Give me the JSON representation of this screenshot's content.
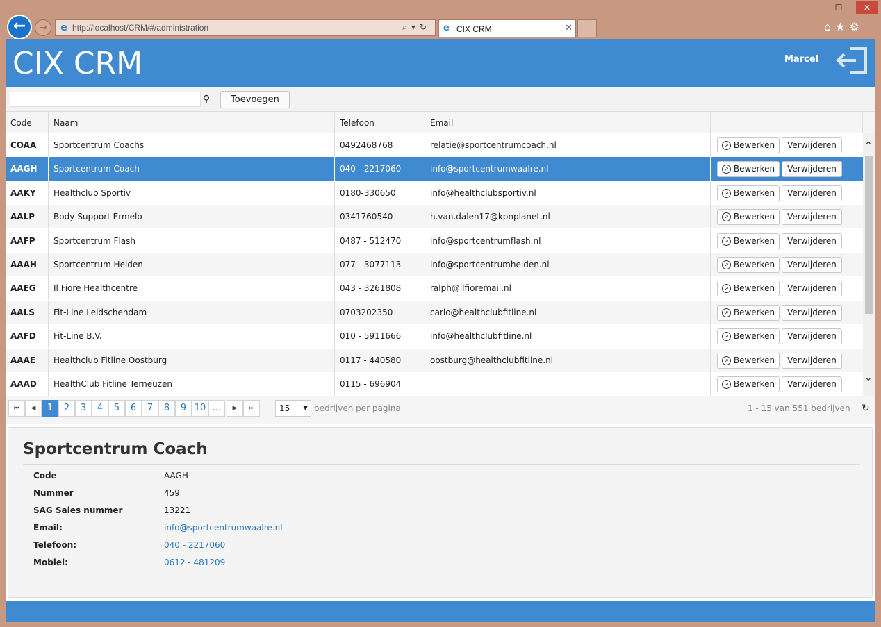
{
  "browser": {
    "url": "http://localhost/CRM/#/administration",
    "tab_title": "CIX CRM"
  },
  "app": {
    "title": "CIX CRM",
    "user": "Marcel"
  },
  "toolbar": {
    "search_value": "",
    "add_label": "Toevoegen"
  },
  "grid": {
    "columns": [
      "Code",
      "Naam",
      "Telefoon",
      "Email",
      ""
    ],
    "edit_label": "Bewerken",
    "delete_label": "Verwijderen",
    "rows": [
      {
        "code": "COAA",
        "naam": "Sportcentrum Coachs",
        "telefoon": "0492468768",
        "email": "relatie@sportcentrumcoach.nl"
      },
      {
        "code": "AAGH",
        "naam": "Sportcentrum Coach",
        "telefoon": "040 - 2217060",
        "email": "info@sportcentrumwaalre.nl",
        "selected": true
      },
      {
        "code": "AAKY",
        "naam": "Healthclub Sportiv",
        "telefoon": "0180-330650",
        "email": "info@healthclubsportiv.nl"
      },
      {
        "code": "AALP",
        "naam": "Body-Support Ermelo",
        "telefoon": "0341760540",
        "email": "h.van.dalen17@kpnplanet.nl"
      },
      {
        "code": "AAFP",
        "naam": "Sportcentrum Flash",
        "telefoon": "0487 - 512470",
        "email": "info@sportcentrumflash.nl"
      },
      {
        "code": "AAAH",
        "naam": "Sportcentrum Helden",
        "telefoon": "077 - 3077113",
        "email": "info@sportcentrumhelden.nl"
      },
      {
        "code": "AAEG",
        "naam": "Il Fiore Healthcentre",
        "telefoon": "043 - 3261808",
        "email": "ralph@ilfioremail.nl"
      },
      {
        "code": "AALS",
        "naam": "Fit-Line Leidschendam",
        "telefoon": "0703202350",
        "email": "carlo@healthclubfitline.nl"
      },
      {
        "code": "AAFD",
        "naam": "Fit-Line B.V.",
        "telefoon": "010 - 5911666",
        "email": "info@healthclubfitline.nl"
      },
      {
        "code": "AAAE",
        "naam": "Healthclub Fitline Oostburg",
        "telefoon": "0117 - 440580",
        "email": "oostburg@healthclubfitline.nl"
      },
      {
        "code": "AAAD",
        "naam": "HealthClub Fitline Terneuzen",
        "telefoon": "0115 - 696904",
        "email": ""
      }
    ]
  },
  "pager": {
    "first": "⏮",
    "prev": "◀",
    "pages": [
      "1",
      "2",
      "3",
      "4",
      "5",
      "6",
      "7",
      "8",
      "9",
      "10",
      "..."
    ],
    "current_page": "1",
    "next": "▶",
    "last": "⏭",
    "page_size": "15",
    "per_page_label": "bedrijven per pagina",
    "range_label": "1 - 15 van 551 bedrijven"
  },
  "detail": {
    "title": "Sportcentrum Coach",
    "fields": [
      {
        "label": "Code",
        "value": "AAGH",
        "link": false
      },
      {
        "label": "Nummer",
        "value": "459",
        "link": false
      },
      {
        "label": "SAG Sales nummer",
        "value": "13221",
        "link": false
      },
      {
        "label": "Email:",
        "value": "info@sportcentrumwaalre.nl",
        "link": true
      },
      {
        "label": "Telefoon:",
        "value": "040 - 2217060",
        "link": true
      },
      {
        "label": "Mobiel:",
        "value": "0612 - 481209",
        "link": true
      }
    ]
  },
  "colors": {
    "brand": "#3f8ad1",
    "link": "#2a7ac0",
    "chrome": "#c89880"
  },
  "icons": {
    "search": "search-icon",
    "logout": "logout-icon",
    "edit": "edit-icon",
    "refresh": "refresh-icon"
  }
}
